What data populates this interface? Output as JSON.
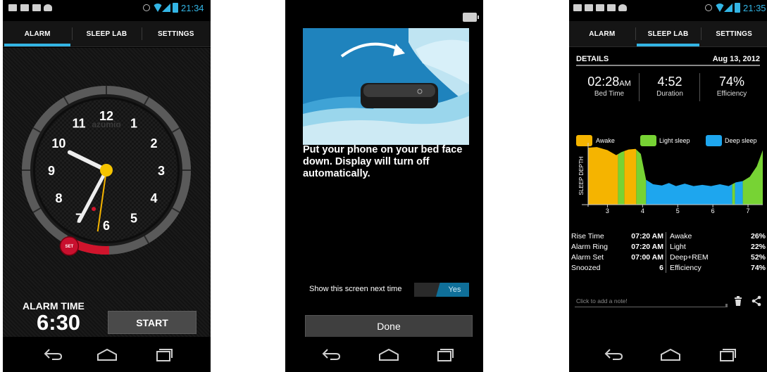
{
  "colors": {
    "accent": "#33b5e5",
    "awake": "#f5b400",
    "light_sleep": "#77d334",
    "deep_sleep": "#1ea6ee",
    "alarm_red": "#d0142c",
    "clock_hand_yellow": "#f5b400"
  },
  "phone1": {
    "status_time": "21:34",
    "tabs": [
      {
        "label": "ALARM",
        "active": true
      },
      {
        "label": "SLEEP LAB",
        "active": false
      },
      {
        "label": "SETTINGS",
        "active": false
      }
    ],
    "clock": {
      "numbers": [
        "12",
        "1",
        "2",
        "3",
        "4",
        "5",
        "6",
        "7",
        "8",
        "9",
        "10",
        "11"
      ],
      "brand": "azumio",
      "set_badge": "SET",
      "hands": {
        "hour": 6.5,
        "minute": 35,
        "alarm": 6.5
      }
    },
    "alarm_label": "ALARM TIME",
    "alarm_time": "6:30",
    "start_label": "START",
    "nav_icons": [
      "back-icon",
      "home-icon",
      "recent-apps-icon"
    ]
  },
  "phone2": {
    "message": "Put your phone on your bed face down. Display will turn off automatically.",
    "toggle_label": "Show this screen next time",
    "toggle_value": "Yes",
    "done_label": "Done"
  },
  "phone3": {
    "status_time": "21:35",
    "tabs": [
      {
        "label": "ALARM",
        "active": false
      },
      {
        "label": "SLEEP LAB",
        "active": true
      },
      {
        "label": "SETTINGS",
        "active": false
      }
    ],
    "details_title": "DETAILS",
    "details_date": "Aug 13, 2012",
    "stats": [
      {
        "value": "02:28",
        "suffix": "AM",
        "label": "Bed Time"
      },
      {
        "value": "4:52",
        "suffix": "",
        "label": "Duration"
      },
      {
        "value": "74%",
        "suffix": "",
        "label": "Efficiency"
      }
    ],
    "legend": [
      "Awake",
      "Light sleep",
      "Deep sleep"
    ],
    "summary_left": [
      {
        "label": "Rise Time",
        "value": "07:20 AM"
      },
      {
        "label": "Alarm Ring",
        "value": "07:20 AM"
      },
      {
        "label": "Alarm Set",
        "value": "07:00 AM"
      },
      {
        "label": "Snoozed",
        "value": "6"
      }
    ],
    "summary_right": [
      {
        "label": "Awake",
        "value": "26%"
      },
      {
        "label": "Light",
        "value": "22%"
      },
      {
        "label": "Deep+REM",
        "value": "52%"
      },
      {
        "label": "Efficiency",
        "value": "74%"
      }
    ],
    "note_placeholder": "Click to add a note!"
  },
  "chart_data": {
    "type": "area",
    "ylabel": "SLEEP DEPTH",
    "xlabel": "",
    "x_ticks": [
      "3",
      "4",
      "5",
      "6",
      "7"
    ],
    "xlim": [
      2.45,
      7.42
    ],
    "ylim": [
      0,
      1
    ],
    "grid": false,
    "legend": "top",
    "series": [
      {
        "name": "Awake",
        "color": "#f5b400",
        "intervals": [
          [
            2.45,
            3.3
          ],
          [
            3.48,
            3.82
          ]
        ]
      },
      {
        "name": "Light sleep",
        "color": "#77d334",
        "intervals": [
          [
            3.3,
            3.48
          ],
          [
            3.82,
            4.1
          ],
          [
            6.55,
            6.63
          ],
          [
            6.85,
            7.42
          ]
        ]
      },
      {
        "name": "Deep sleep",
        "color": "#1ea6ee",
        "intervals": [
          [
            4.1,
            6.55
          ],
          [
            6.63,
            6.85
          ]
        ]
      }
    ],
    "depth_profile": [
      [
        2.45,
        0.92
      ],
      [
        2.7,
        0.93
      ],
      [
        3.0,
        0.88
      ],
      [
        3.25,
        0.8
      ],
      [
        3.4,
        0.85
      ],
      [
        3.6,
        0.89
      ],
      [
        3.8,
        0.9
      ],
      [
        3.95,
        0.82
      ],
      [
        4.1,
        0.4
      ],
      [
        4.3,
        0.33
      ],
      [
        4.55,
        0.31
      ],
      [
        4.75,
        0.35
      ],
      [
        4.95,
        0.3
      ],
      [
        5.2,
        0.34
      ],
      [
        5.45,
        0.3
      ],
      [
        5.7,
        0.32
      ],
      [
        5.95,
        0.3
      ],
      [
        6.2,
        0.33
      ],
      [
        6.45,
        0.3
      ],
      [
        6.65,
        0.36
      ],
      [
        6.85,
        0.38
      ],
      [
        7.05,
        0.45
      ],
      [
        7.25,
        0.62
      ],
      [
        7.42,
        0.88
      ]
    ]
  }
}
